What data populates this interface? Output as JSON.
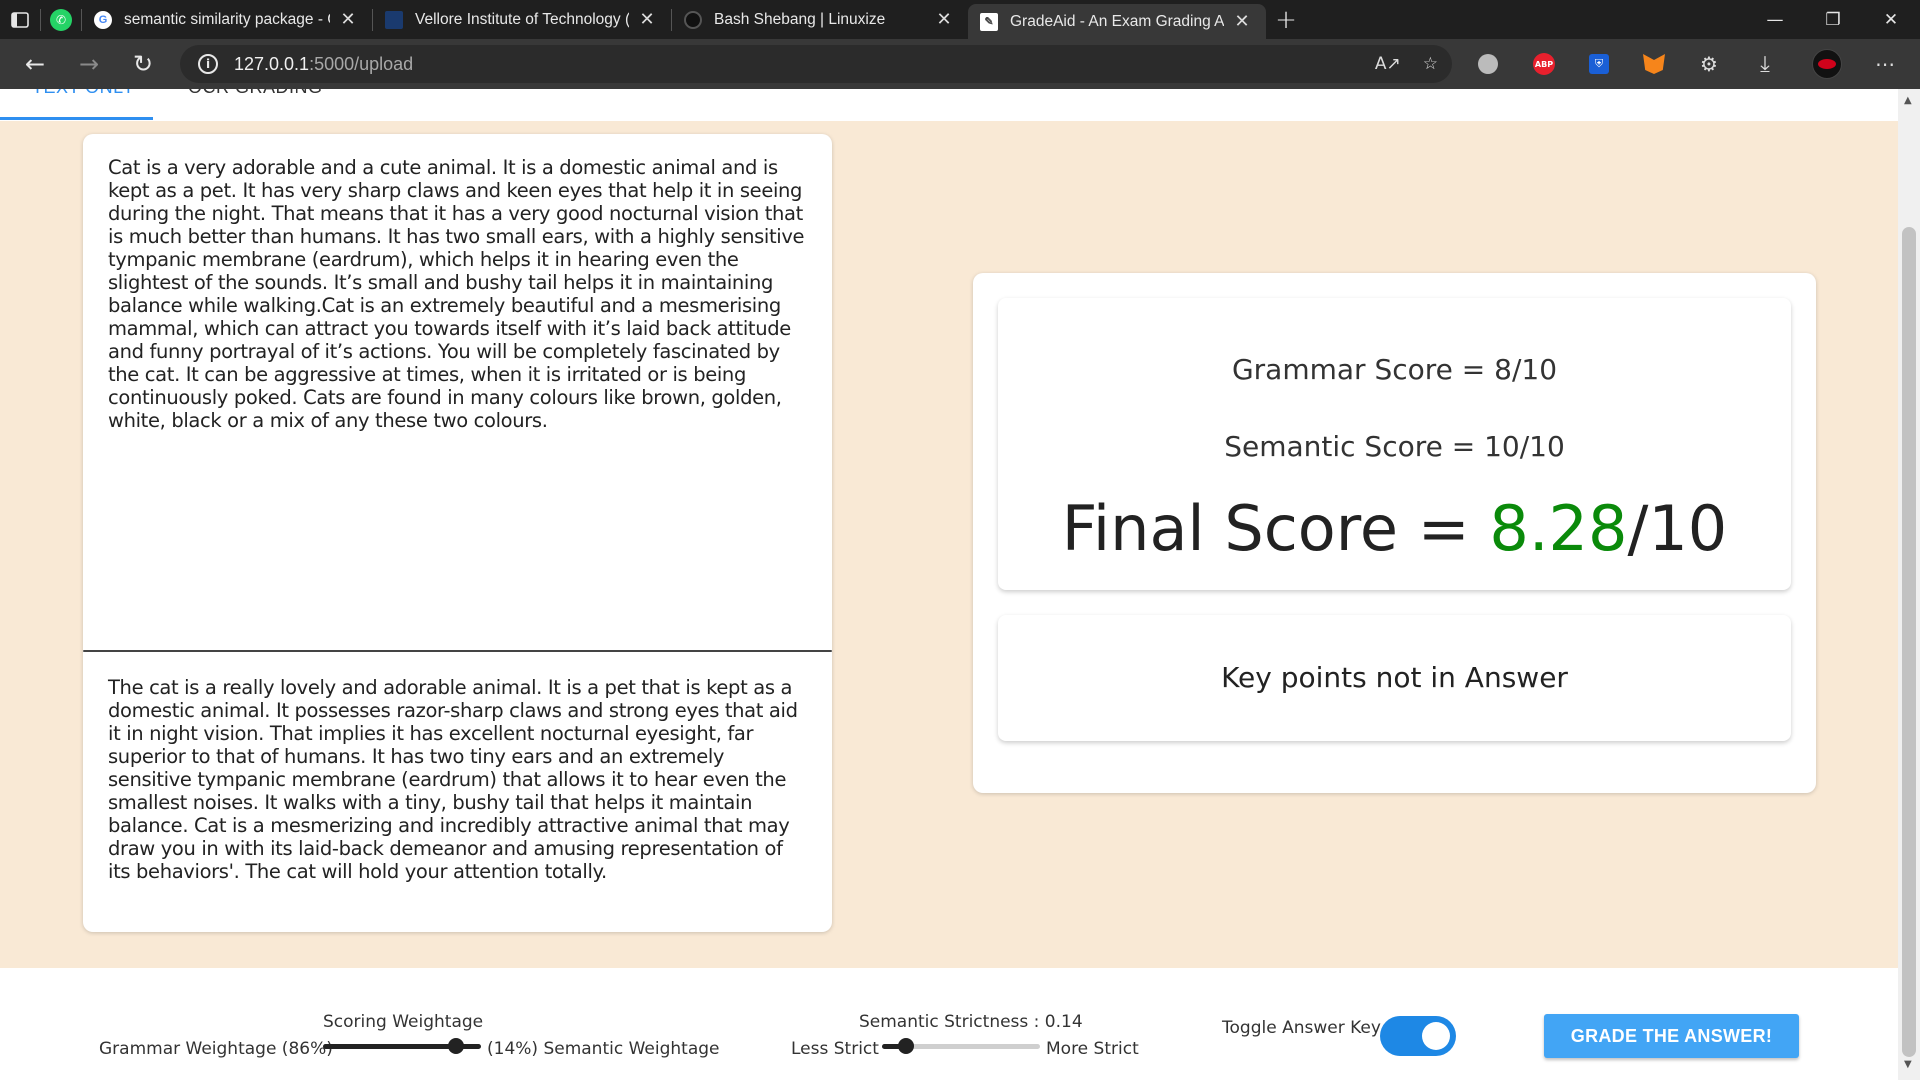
{
  "browser": {
    "tabs": [
      {
        "title": "semantic similarity package - Go",
        "active": false
      },
      {
        "title": "Vellore Institute of Technology (V",
        "active": false
      },
      {
        "title": "Bash Shebang | Linuxize",
        "active": false
      },
      {
        "title": "GradeAid - An Exam Grading Ass",
        "active": true
      }
    ],
    "url_host": "127.0.0.1",
    "url_path": ":5000/upload",
    "extensions": {
      "abp_label": "ABP"
    }
  },
  "page_tabs": {
    "text_only": "TEXT ONLY",
    "ocr_grading": "OCR GRADING"
  },
  "answer_key_text": "Cat is a very adorable and a cute animal. It is a domestic animal and is kept as a pet. It has very sharp claws and keen eyes that help it in seeing during the night. That means that it has a very good nocturnal vision that is much better than humans. It has two small ears, with a highly sensitive tympanic membrane (eardrum), which helps it in hearing even the slightest of the sounds. It’s small and bushy tail helps it in maintaining balance while walking.Cat is an extremely beautiful and a mesmerising mammal, which can attract you towards itself with it’s laid back attitude and funny portrayal of it’s actions. You will be completely fascinated by the cat. It can be aggressive at times, when it is irritated or is being continuously poked. Cats are found in many colours like brown, golden, white, black or a mix of any these two colours.",
  "student_answer_text": "The cat is a really lovely and adorable animal. It is a pet that is kept as a domestic animal. It possesses razor-sharp claws and strong eyes that aid it in night vision. That implies it has excellent nocturnal eyesight, far superior to that of humans. It has two tiny ears and an extremely sensitive tympanic membrane (eardrum) that allows it to hear even the smallest noises. It walks with a tiny, bushy tail that helps it maintain balance. Cat is a mesmerizing and incredibly attractive animal that may draw you in with its laid-back demeanor and amusing representation of its behaviors'. The cat will hold your attention totally.",
  "results": {
    "grammar_label": "Grammar Score = 8/10",
    "semantic_label": "Semantic Score = 10/10",
    "final_prefix": "Final Score = ",
    "final_value": "8.28",
    "final_suffix": "/10",
    "final_value_color": "#0a8a0a",
    "key_points_title": "Key points not in Answer"
  },
  "controls": {
    "scoring_weightage_title": "Scoring Weightage",
    "grammar_weightage_label": "Grammar Weightage (86%)",
    "semantic_weightage_label": "(14%) Semantic Weightage",
    "scoring_weightage_value": 0.86,
    "semantic_strictness_title": "Semantic Strictness : 0.14",
    "less_strict_label": "Less Strict",
    "more_strict_label": "More Strict",
    "strictness_value": 0.14,
    "toggle_label": "Toggle Answer Key",
    "toggle_on": true,
    "grade_button": "GRADE THE ANSWER!"
  }
}
